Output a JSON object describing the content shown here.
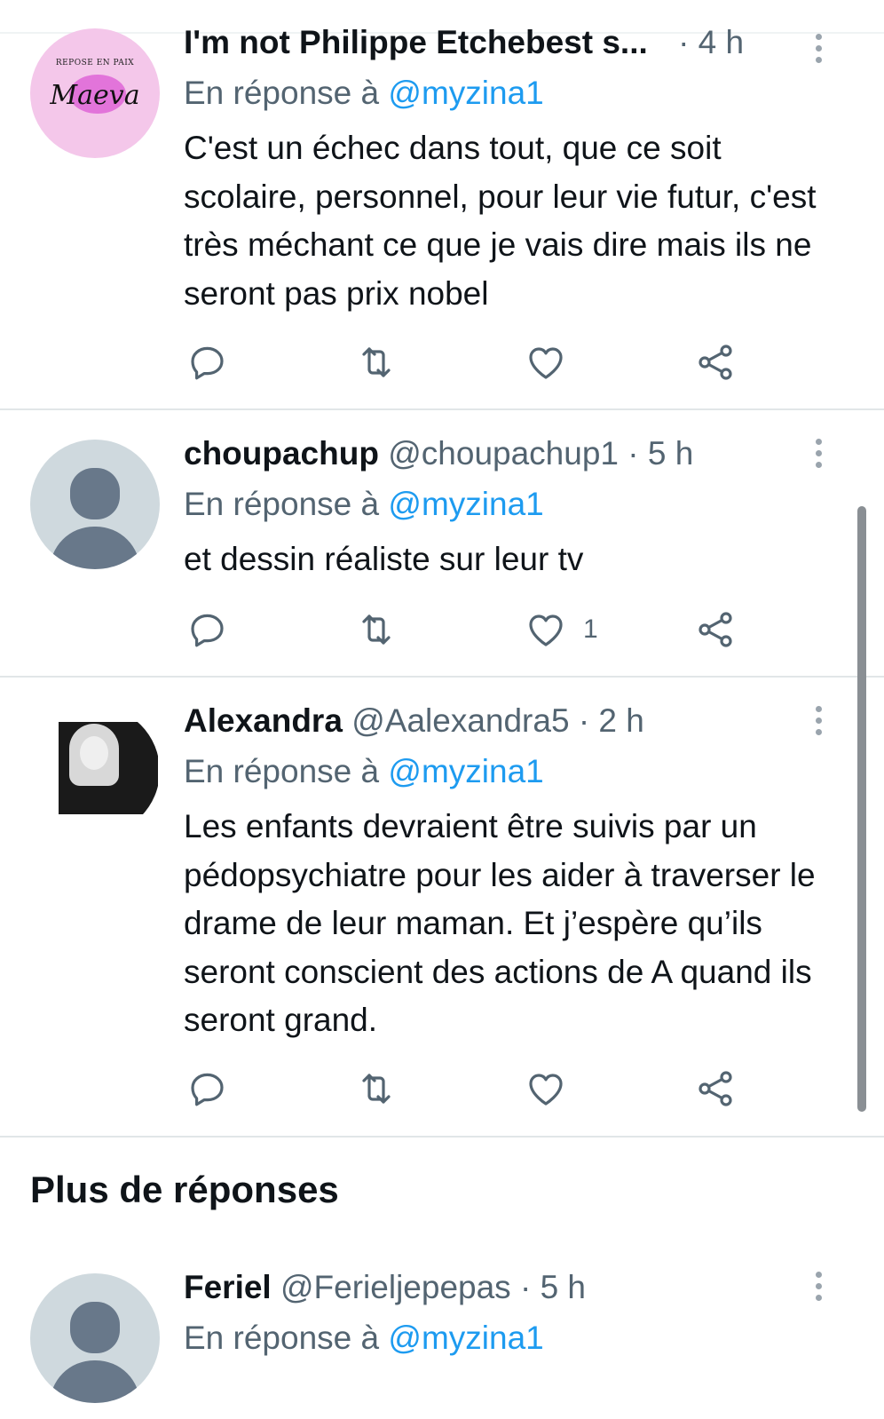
{
  "colors": {
    "accent": "#1d9bf0",
    "muted": "#536471",
    "text": "#0f1419",
    "divider": "#e1e6e8",
    "avatar_default": "#cfd9de"
  },
  "icons": {
    "reply": "reply-icon",
    "retweet": "retweet-icon",
    "like": "heart-icon",
    "share": "share-icon",
    "more": "more-icon"
  },
  "tweets": [
    {
      "name": "I'm not Philippe Etchebest s...",
      "handle": "",
      "time": "· 4 h",
      "reply_prefix": "En réponse à",
      "reply_to": "@myzina1",
      "text": "C'est un échec dans tout, que ce soit scolaire, personnel, pour leur vie futur, c'est très méchant ce que je vais dire mais ils ne seront pas prix nobel",
      "avatar": {
        "caption": "REPOSE EN PAIX",
        "signature": "Maeva"
      },
      "likes": ""
    },
    {
      "name": "choupachup",
      "handle": "@choupachup1",
      "time": "· 5 h",
      "reply_prefix": "En réponse à",
      "reply_to": "@myzina1",
      "text": "et dessin réaliste sur leur tv",
      "likes": "1"
    },
    {
      "name": "Alexandra",
      "handle": "@Aalexandra5",
      "time": "· 2 h",
      "reply_prefix": "En réponse à",
      "reply_to": "@myzina1",
      "text": "Les enfants devraient être suivis par un pédopsychiatre pour les aider à traverser le drame de leur maman. Et j’espère qu’ils seront conscient des actions de A quand ils seront grand.",
      "likes": ""
    }
  ],
  "section_title": "Plus de réponses",
  "more_tweets": [
    {
      "name": "Feriel",
      "handle": "@Ferieljepepas",
      "time": "· 5 h",
      "reply_prefix": "En réponse à",
      "reply_to": "@myzina1"
    }
  ]
}
